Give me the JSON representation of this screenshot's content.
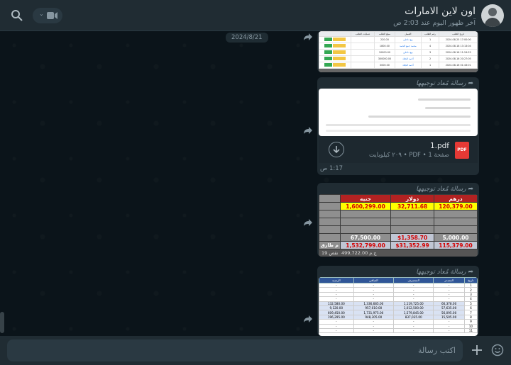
{
  "header": {
    "title": "اون لاين الامارات",
    "subtitle": "آخر ظهور اليوم عند 2:03 ص",
    "icons": [
      "avatar",
      "search-icon",
      "video-call-icon",
      "chevron-down-icon"
    ]
  },
  "chat": {
    "date_chip": "2024/8/21",
    "forwarded_label": "رسالة مُعاد توجيهها",
    "bubble1": {
      "columns": [
        "تاريخ الطلب",
        "رقم الطلب",
        "العميل",
        "مبلغ الطلب",
        "عمليات الطلب"
      ],
      "rows": [
        [
          "2024-08-25 17:00:00",
          "1",
          "بيع داخلي",
          "220.00"
        ],
        [
          "2024-08-18 13:13:04",
          "4",
          "محمد جمع الحمد",
          "1800.00"
        ],
        [
          "2024-08-16 11:24:25",
          "3",
          "بيع داخلي",
          "10000.00"
        ],
        [
          "2024-08-16 20:27:05",
          "2",
          "أحمد الجلاد",
          "300000.00"
        ],
        [
          "2024-08-16 01:43:01",
          "1",
          "أحمد الجلاد",
          "3000.00"
        ]
      ]
    },
    "bubble2": {
      "file_name": "1.pdf",
      "file_info": "صفحة 1 • PDF • ٢٠٩ كيلوبايت",
      "pdf_badge": "PDF",
      "time": "1:17 ص"
    },
    "bubble3": {
      "headers": [
        "درهم",
        "دولار",
        "جنيه"
      ],
      "row1": [
        "120,379.00",
        "32,711.68",
        "1,600,299.00"
      ],
      "row2": [
        "5,000.00",
        "$1,358.70",
        "67,500.00"
      ],
      "row3": [
        "115,379.00",
        "$31,352.99",
        "1,532,799.00"
      ],
      "row3_label": "م طارق",
      "footer_left": "ج.م 499,722.00",
      "footer_right": "19 نقص"
    },
    "bubble4": {
      "columns": [
        "تاريخ",
        "المصدر",
        "المنصرف",
        "الصافي",
        "الرصيد"
      ],
      "rows": [
        [
          "1",
          "-",
          "-",
          "-",
          "-"
        ],
        [
          "2",
          "-",
          "-",
          "-",
          "-"
        ],
        [
          "3",
          "-",
          "-",
          "-",
          "-"
        ],
        [
          "4",
          "-",
          "-",
          "-",
          "-"
        ],
        [
          "5",
          "66,378.00",
          "1,119,725.00",
          "1,336,685.00",
          "132,580.00"
        ],
        [
          "6",
          "57,635.00",
          "1,012,500.00",
          "957,010.00",
          "9,120.00"
        ],
        [
          "7",
          "56,095.00",
          "1,579,845.00",
          "1,731,975.00",
          "609,450.00"
        ],
        [
          "8",
          "15,505.00",
          "837,035.00",
          "948,305.00",
          "196,295.00"
        ],
        [
          "9",
          "-",
          "-",
          "-",
          "-"
        ],
        [
          "10",
          "-",
          "-",
          "-",
          "-"
        ],
        [
          "11",
          "-",
          "-",
          "-",
          "-"
        ]
      ]
    }
  },
  "composer": {
    "placeholder": "اكتب رسالة"
  }
}
